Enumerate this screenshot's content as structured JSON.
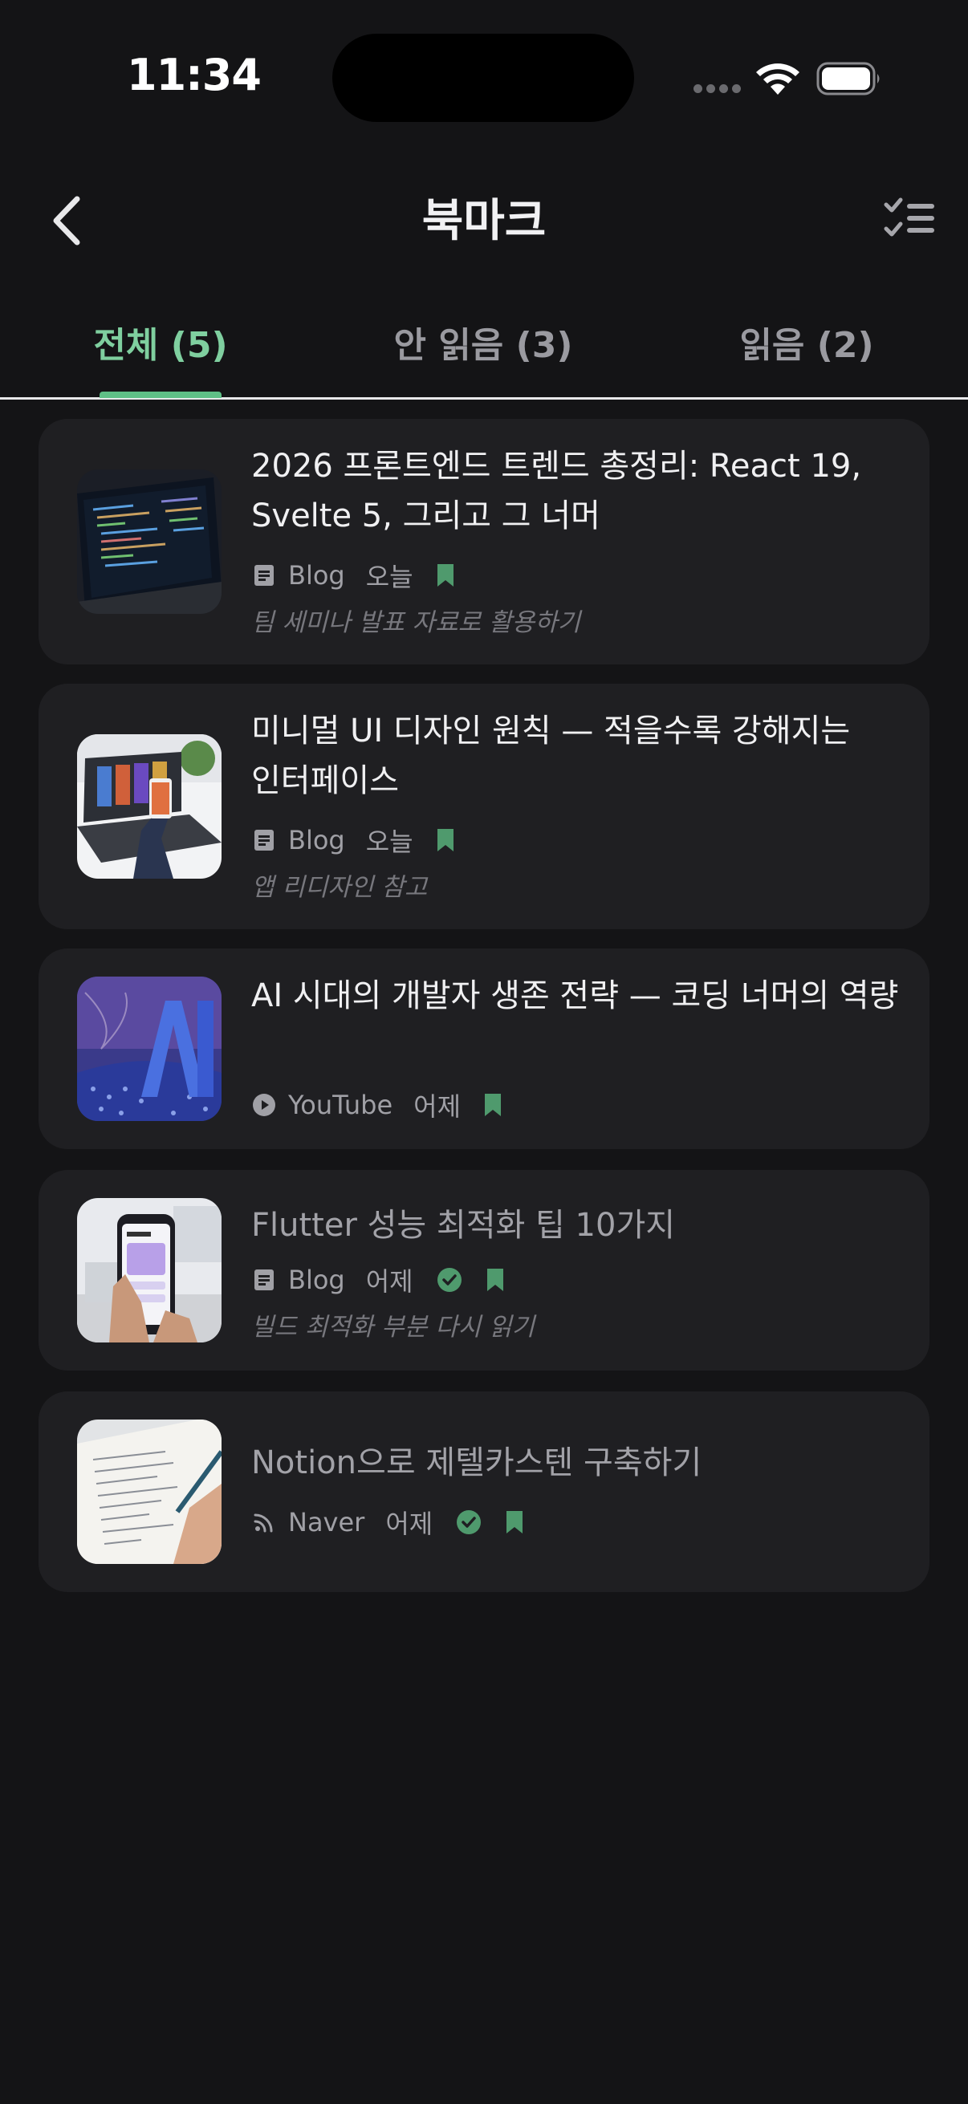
{
  "status_bar": {
    "time": "11:34"
  },
  "header": {
    "title": "북마크"
  },
  "tabs": [
    {
      "label": "전체 (5)",
      "active": true
    },
    {
      "label": "안 읽음 (3)",
      "active": false
    },
    {
      "label": "읽음 (2)",
      "active": false
    }
  ],
  "colors": {
    "accent": "#5fbf86",
    "background": "#141416",
    "card": "#1f1f22",
    "bookmark": "#4f9a6d"
  },
  "bookmarks": [
    {
      "title": "2026 프론트엔드 트렌드 총정리: React 19, Svelte 5, 그리고 그 너머",
      "source": "Blog",
      "source_icon": "document-icon",
      "date": "오늘",
      "read": false,
      "note": "팀 세미나 발표 자료로 활용하기"
    },
    {
      "title": "미니멀 UI 디자인 원칙 — 적을수록 강해지는 인터페이스",
      "source": "Blog",
      "source_icon": "document-icon",
      "date": "오늘",
      "read": false,
      "note": "앱 리디자인 참고"
    },
    {
      "title": "AI 시대의 개발자 생존 전략 — 코딩 너머의 역량",
      "source": "YouTube",
      "source_icon": "play-circle-icon",
      "date": "어제",
      "read": false,
      "note": ""
    },
    {
      "title": "Flutter 성능 최적화 팁 10가지",
      "source": "Blog",
      "source_icon": "document-icon",
      "date": "어제",
      "read": true,
      "note": "빌드 최적화 부분 다시 읽기"
    },
    {
      "title": "Notion으로 제텔카스텐 구축하기",
      "source": "Naver",
      "source_icon": "rss-icon",
      "date": "어제",
      "read": true,
      "note": ""
    }
  ]
}
